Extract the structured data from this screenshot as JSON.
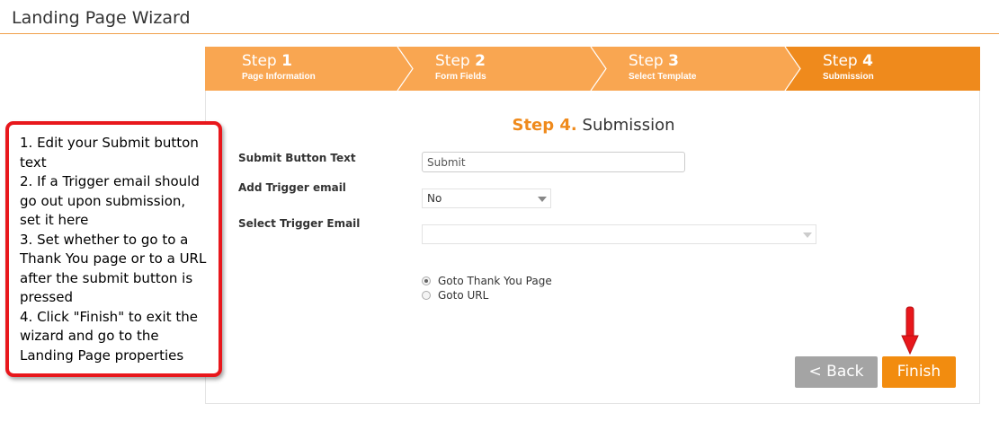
{
  "page": {
    "title": "Landing Page Wizard"
  },
  "colors": {
    "accent": "#ef8a1c",
    "step_inactive": "#f9a651",
    "step_active": "#ef8a1c",
    "back_button": "#a4a4a4",
    "finish_button": "#f28c0f",
    "callout_border": "#e8171c",
    "arrow": "#e8171c"
  },
  "wizard": {
    "steps": [
      {
        "word": "Step",
        "num": "1",
        "label": "Page Information",
        "active": false
      },
      {
        "word": "Step",
        "num": "2",
        "label": "Form Fields",
        "active": false
      },
      {
        "word": "Step",
        "num": "3",
        "label": "Select Template",
        "active": false
      },
      {
        "word": "Step",
        "num": "4",
        "label": "Submission",
        "active": true
      }
    ],
    "section": {
      "num": "Step 4.",
      "title": "Submission"
    },
    "fields": {
      "submit_text_label": "Submit Button Text",
      "submit_text_value": "Submit",
      "trigger_label": "Add Trigger email",
      "trigger_value": "No",
      "select_trigger_label": "Select Trigger Email",
      "select_trigger_value": ""
    },
    "radios": [
      {
        "label": "Goto Thank You Page",
        "checked": true
      },
      {
        "label": "Goto URL",
        "checked": false
      }
    ],
    "buttons": {
      "back": "<  Back",
      "finish": "Finish"
    }
  },
  "callout": {
    "lines": [
      "1. Edit your Submit button text",
      "2. If a Trigger email should go out upon submission, set it here",
      "3. Set whether to go to a Thank You page or to a URL after the submit button is pressed",
      "4. Click \"Finish\" to exit the wizard and go to the Landing Page properties"
    ]
  },
  "icons": {
    "dropdown": "chevron-down-icon",
    "pointer": "red-arrow-down-icon"
  }
}
